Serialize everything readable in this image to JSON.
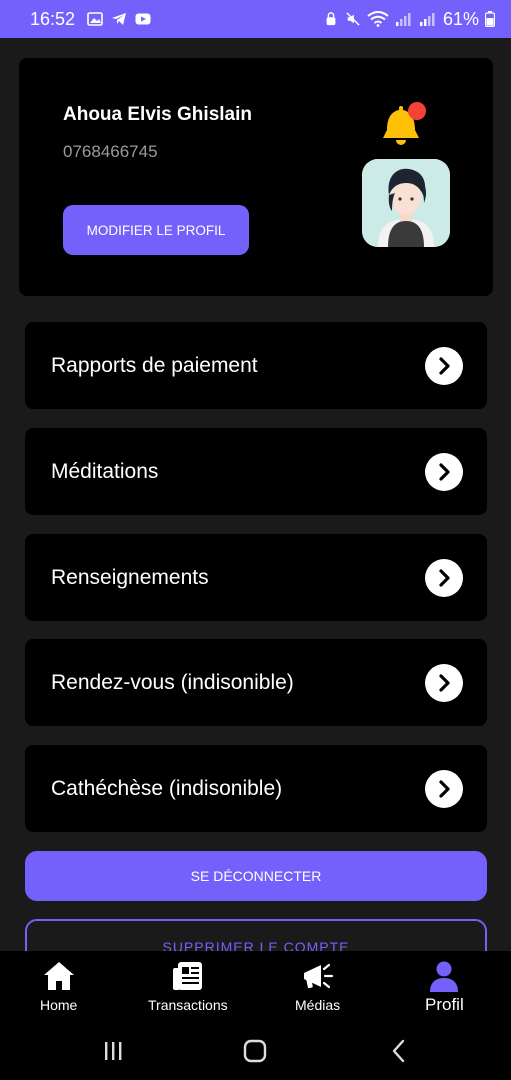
{
  "status_bar": {
    "time": "16:52",
    "battery": "61%"
  },
  "profile": {
    "name": "Ahoua Elvis Ghislain",
    "phone": "0768466745",
    "edit_button": "MODIFIER LE PROFIL",
    "has_notification": true
  },
  "menu": [
    {
      "label": "Rapports de paiement"
    },
    {
      "label": "Méditations"
    },
    {
      "label": "Renseignements"
    },
    {
      "label": "Rendez-vous (indisonible)"
    },
    {
      "label": "Cathéchèse (indisonible)"
    }
  ],
  "logout_button": "SE DÉCONNECTER",
  "delete_button": "SUPPRIMER LE COMPTE",
  "bottom_nav": [
    {
      "label": "Home",
      "icon": "home-icon"
    },
    {
      "label": "Transactions",
      "icon": "newspaper-icon"
    },
    {
      "label": "Médias",
      "icon": "megaphone-icon"
    },
    {
      "label": "Profil",
      "icon": "user-icon",
      "active": true
    }
  ],
  "colors": {
    "accent": "#7461fb",
    "background": "#1a1a1a",
    "card": "#000000",
    "notification": "#f44336",
    "bell": "#ffc107"
  }
}
